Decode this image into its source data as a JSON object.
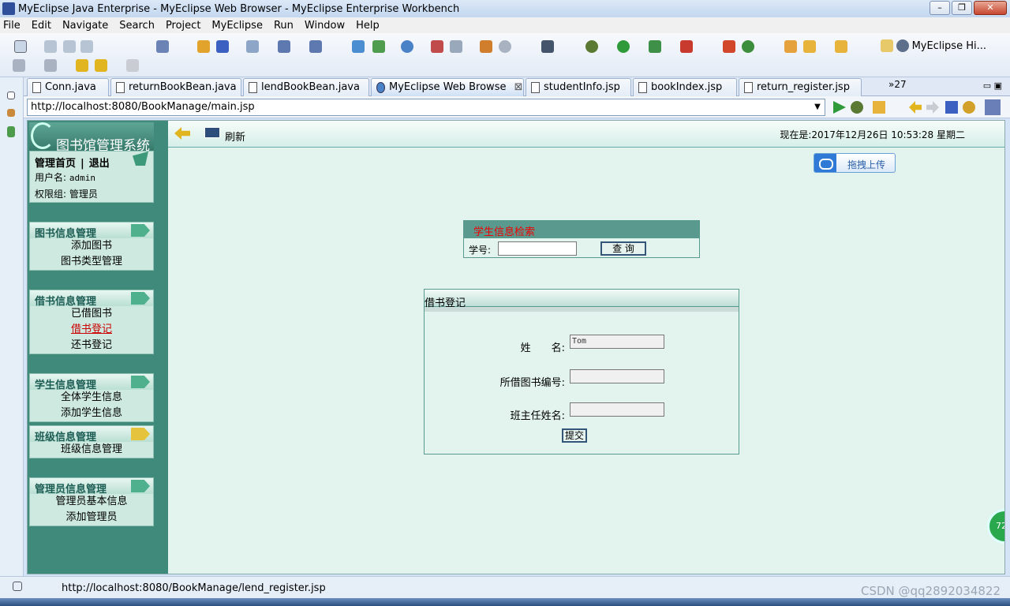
{
  "window": {
    "title": "MyEclipse Java Enterprise - MyEclipse Web Browser - MyEclipse Enterprise Workbench"
  },
  "menu": [
    "File",
    "Edit",
    "Navigate",
    "Search",
    "Project",
    "MyEclipse",
    "Run",
    "Window",
    "Help"
  ],
  "toolbar": {
    "perspective_label": "MyEclipse Hi..."
  },
  "tabs": [
    {
      "label": "Conn.java"
    },
    {
      "label": "returnBookBean.java"
    },
    {
      "label": "lendBookBean.java"
    },
    {
      "label": "MyEclipse Web Browse",
      "active": true
    },
    {
      "label": "studentInfo.jsp"
    },
    {
      "label": "bookIndex.jsp"
    },
    {
      "label": "return_register.jsp"
    }
  ],
  "tabs_overflow": "»27",
  "browser": {
    "url": "http://localhost:8080/BookManage/main.jsp"
  },
  "page": {
    "logo_text": "图书馆管理系统",
    "user_panel": {
      "home_link": "管理首页",
      "logout_link": "退出",
      "username_line": "用户名:",
      "username": "admin",
      "role_line": "权限组: 管理员"
    },
    "menus": [
      {
        "title": "图书信息管理",
        "items": [
          "添加图书",
          "图书类型管理"
        ]
      },
      {
        "title": "借书信息管理",
        "items": [
          "已借图书",
          "借书登记",
          "还书登记"
        ]
      },
      {
        "title": "学生信息管理",
        "items": [
          "全体学生信息",
          "添加学生信息"
        ]
      },
      {
        "title": "班级信息管理",
        "items": [
          "班级信息管理"
        ]
      },
      {
        "title": "管理员信息管理",
        "items": [
          "管理员基本信息",
          "添加管理员"
        ]
      }
    ],
    "refresh_label": "刷新",
    "clock": "现在是:2017年12月26日 10:53:28 星期二",
    "upload_label": "拖拽上传",
    "search": {
      "title": "学生信息检索",
      "label": "学号:",
      "button": "查 询"
    },
    "form": {
      "title": "借书登记",
      "name_label": "姓　　名:",
      "name_value": "Tom",
      "book_label": "所借图书编号:",
      "book_value": "",
      "teacher_label": "班主任姓名:",
      "teacher_value": "",
      "submit": "提交"
    }
  },
  "status": {
    "text": "http://localhost:8080/BookManage/lend_register.jsp",
    "watermark": "CSDN @qq2892034822"
  },
  "float_ball": "72"
}
